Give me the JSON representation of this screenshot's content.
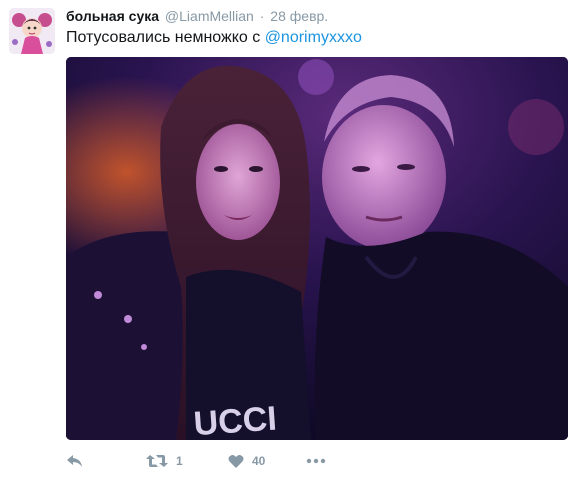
{
  "author": {
    "display_name": "больная сука",
    "handle": "@LiamMellian"
  },
  "timestamp_separator": "·",
  "timestamp": "28 февр.",
  "tweet": {
    "text_before": "Потусовались немножко с ",
    "mention": "@norimyxxxo"
  },
  "actions": {
    "reply_icon": "reply-icon",
    "retweet_icon": "retweet-icon",
    "retweet_count": "1",
    "like_icon": "heart-icon",
    "like_count": "40",
    "more_icon": "more-icon"
  },
  "colors": {
    "link": "#1b95e0",
    "muted": "#8899a6",
    "text": "#14171a"
  }
}
